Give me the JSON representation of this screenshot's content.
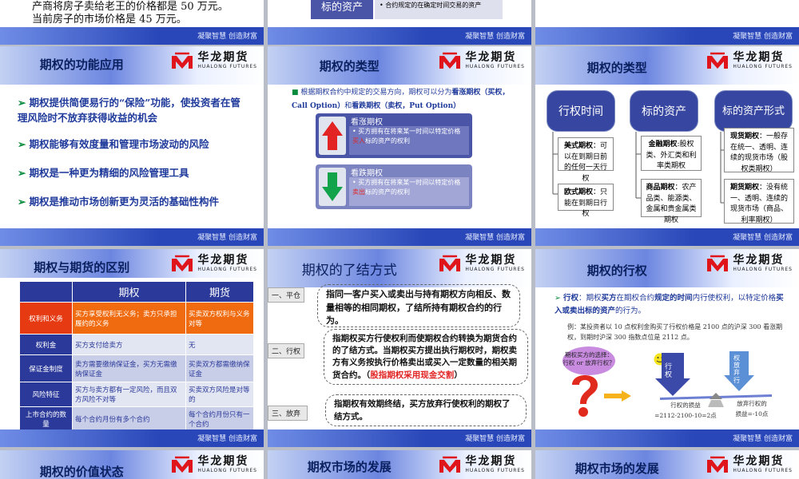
{
  "footer_text": "凝聚智慧 创造财富",
  "logo": {
    "cn": "华龙期货",
    "en": "HUALONG FUTURES",
    "color": "#e0151b"
  },
  "top_left": {
    "line1": "产商将房子卖给老王的价格都是 50 万元。",
    "line2": "当前房子的市场价格是 45 万元。"
  },
  "top_mid": {
    "label": "标的资产",
    "text": "合约规定的在确定时间交易的资产"
  },
  "s_func": {
    "title": "期权的功能应用",
    "bullets": [
      "期权提供简便易行的“保险”功能，使投资者在管理风险时不放弃获得收益的机会",
      "期权能够有效度量和管理市场波动的风险",
      "期权是一种更为精细的风险管理工具",
      "期权是推动市场创新更为灵活的基础性构件"
    ]
  },
  "s_type1": {
    "title": "期权的类型",
    "intro_a": "根据期权合约中规定的交易方向，期权可以分为",
    "intro_b": "看涨期权（买权，Call Option）",
    "intro_c": "和",
    "intro_d": "看跌期权（卖权，Put Option）",
    "call_title": "看涨期权",
    "call_a": "买方拥有在将来某一时间以特定价格",
    "call_b": "买入",
    "call_c": "标的资产的权利",
    "put_title": "看跌期权",
    "put_a": "买方拥有在将来某一时间以特定价格",
    "put_b": "卖出",
    "put_c": "标的资产的权利"
  },
  "s_type2": {
    "title": "期权的类型",
    "cats": [
      "行权时间",
      "标的资产",
      "标的资产形式"
    ],
    "c1a_b": "美式期权",
    "c1a": "：可以在到期日前的任何一天行权",
    "c1b_b": "欧式期权",
    "c1b": "：只能在到期日行权",
    "c2a_b": "金融期权",
    "c2a": ":股权类、外汇类和利率类期权",
    "c2b_b": "商品期权",
    "c2b": "：农产品类、能源类、金属和贵金属类期权",
    "c3a_b": "现货期权",
    "c3a": "：一般存在统一、透明、连续的现货市场（股权类期权）",
    "c3b_b": "期货期权",
    "c3b": "：没有统一、透明、连续的现货市场（商品、利率期权）"
  },
  "s_diff": {
    "title": "期权与期货的区别",
    "headers": [
      "期权",
      "期货"
    ],
    "rows": [
      [
        "权利和义务",
        "买方享受权利无义务；卖方只承担履约的义务",
        "买卖双方权利与义务对等"
      ],
      [
        "权利金",
        "买方支付给卖方",
        "无"
      ],
      [
        "保证金制度",
        "卖方需要缴纳保证金，买方无需缴纳保证金",
        "买卖双方都需缴纳保证金"
      ],
      [
        "风险特征",
        "买方与卖方都有一定风险，而且双方风险不对等",
        "买卖双方风险是对等的"
      ],
      [
        "上市合约的数量",
        "每个合约月份有多个合约",
        "每个合约月份只有一个合约"
      ]
    ]
  },
  "s_close": {
    "title": "期权的了结方式",
    "t1": "一、平仓",
    "d1": "指同一客户买入或卖出与持有期权方向相反、数量相等的相同期权，了结所持有期权合约的行为。",
    "t2": "二、行权",
    "d2a": "指期权买方行使权利而使期权合约转换为期货合约的了结方式。当期权买方提出执行期权时，期权卖方有义务按执行价格卖出或买入一定数量的相关期货合约。（",
    "d2b": "股指期权采用现金交割",
    "d2c": "）",
    "t3": "三、放弃",
    "d3": "指期权有效期终结，买方放弃行使权利的期权了结方式。"
  },
  "s_exer": {
    "title": "期权的行权",
    "def_a": "行权",
    "def_b": "：期权",
    "def_c": "买方",
    "def_d": "在期权合约",
    "def_e": "规定的时间",
    "def_f": "内行使权利，以特定价格",
    "def_g": "买入或卖出标的资产",
    "def_h": "的行为。",
    "example": "例：某投资者以 10 点权利金购买了行权价格是 2100 点的沪深 300 看涨期权，到期时沪深 300 指数点位是 2112 点。",
    "bubble": "期权买方的选择：行权 or 放弃行权？",
    "arrow_left": "行权",
    "arrow_right": "权放弃行",
    "calc_left_1": "行权的损益",
    "calc_left_2": "=2112-2100-10=2点",
    "calc_right_1": "放弃行权的",
    "calc_right_2": "损益=-10点"
  },
  "bottom_titles": [
    "期权的价值状态",
    "期权市场的发展",
    "期权市场的发展"
  ]
}
